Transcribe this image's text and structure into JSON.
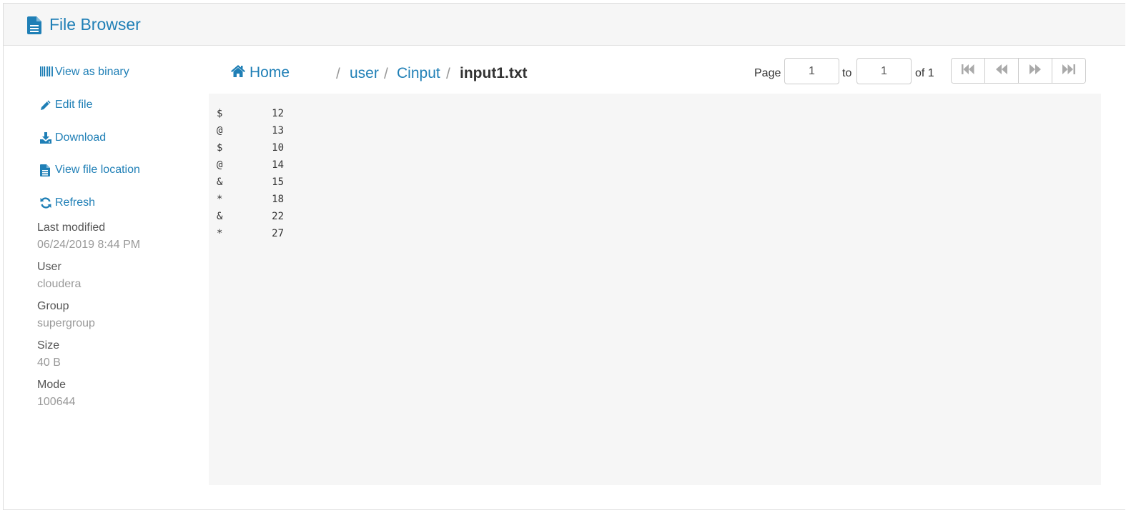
{
  "header": {
    "title": "File Browser",
    "icon": "file-text-icon"
  },
  "sidebar": {
    "actions": [
      {
        "label": "View as binary",
        "icon": "barcode-icon"
      },
      {
        "label": "Edit file",
        "icon": "pencil-icon"
      },
      {
        "label": "Download",
        "icon": "download-icon"
      },
      {
        "label": "View file location",
        "icon": "file-text-icon"
      },
      {
        "label": "Refresh",
        "icon": "refresh-icon"
      }
    ],
    "meta": [
      {
        "label": "Last modified",
        "value": "06/24/2019 8:44 PM"
      },
      {
        "label": "User",
        "value": "cloudera"
      },
      {
        "label": "Group",
        "value": "supergroup"
      },
      {
        "label": "Size",
        "value": "40 B"
      },
      {
        "label": "Mode",
        "value": "100644"
      }
    ]
  },
  "breadcrumb": {
    "home": "Home",
    "separator": "/",
    "parts": [
      "user",
      "Cinput"
    ],
    "current": "input1.txt"
  },
  "pagination": {
    "page_label": "Page",
    "from_value": "1",
    "to_label": "to",
    "to_value": "1",
    "of_label": "of 1",
    "buttons": [
      "first-page-icon",
      "previous-page-icon",
      "next-page-icon",
      "last-page-icon"
    ]
  },
  "file_contents": [
    [
      "$",
      "12"
    ],
    [
      "@",
      "13"
    ],
    [
      "$",
      "10"
    ],
    [
      "@",
      "14"
    ],
    [
      "&",
      "15"
    ],
    [
      "*",
      "18"
    ],
    [
      "&",
      "22"
    ],
    [
      "*",
      "27"
    ]
  ],
  "colors": {
    "accent": "#1f7fb6",
    "header_bg": "#f6f6f6",
    "content_bg": "#f6f6f6",
    "muted_text": "#999999"
  }
}
